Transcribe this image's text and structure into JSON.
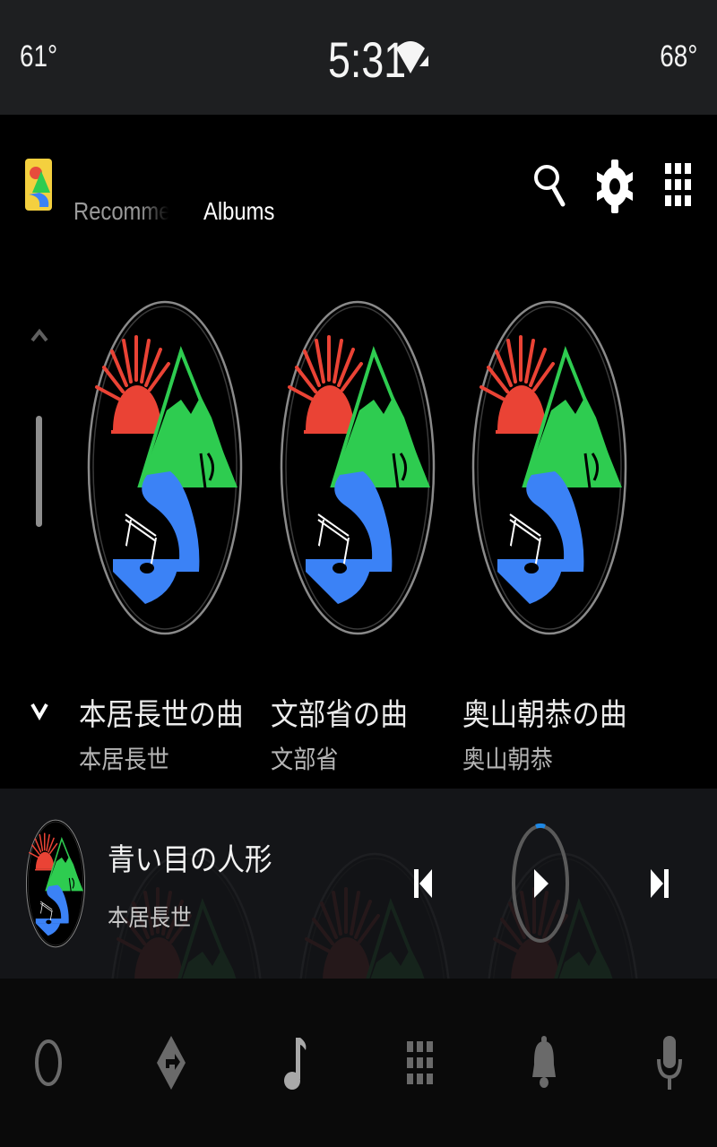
{
  "status_bar": {
    "temp_left": "61°",
    "clock": "5:31",
    "temp_right": "68°",
    "icons": [
      "wifi-icon",
      "cell-signal-icon"
    ]
  },
  "header": {
    "app_icon": "music-app-icon",
    "tabs": [
      {
        "label": "Recommended",
        "active": false
      },
      {
        "label": "Albums",
        "active": true
      }
    ],
    "actions": [
      "search-icon",
      "gear-icon",
      "app-grid-icon"
    ]
  },
  "albums": [
    {
      "title": "本居長世の曲",
      "artist": "本居長世"
    },
    {
      "title": "文部省の曲",
      "artist": "文部省"
    },
    {
      "title": "奥山朝恭の曲",
      "artist": "奥山朝恭"
    }
  ],
  "now_playing": {
    "title": "青い目の人形",
    "artist": "本居長世",
    "state": "paused",
    "controls": [
      "skip-previous-icon",
      "play-icon",
      "skip-next-icon"
    ]
  },
  "nav_bar": {
    "items": [
      "home-icon",
      "navigation-icon",
      "music-note-icon",
      "app-grid-icon",
      "bell-icon",
      "microphone-icon"
    ],
    "active": "music-note-icon"
  },
  "colors": {
    "status_bar_bg": "#1e1f21",
    "now_playing_bg": "#141518",
    "progress_accent": "#1e88e5",
    "sun": "#e74c3c",
    "mountain": "#2ecc50",
    "river": "#3b82f6"
  }
}
